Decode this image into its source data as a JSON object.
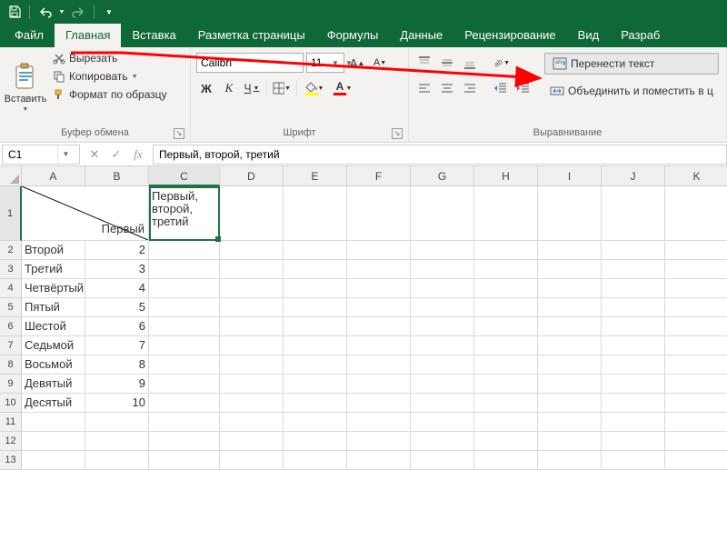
{
  "qat": {
    "save": "save",
    "undo": "undo",
    "redo": "redo",
    "customize": "customize"
  },
  "tabs": [
    "Файл",
    "Главная",
    "Вставка",
    "Разметка страницы",
    "Формулы",
    "Данные",
    "Рецензирование",
    "Вид",
    "Разраб"
  ],
  "active_tab": 1,
  "clipboard": {
    "paste": "Вставить",
    "cut": "Вырезать",
    "copy": "Копировать",
    "format_painter": "Формат по образцу",
    "group": "Буфер обмена"
  },
  "font": {
    "name": "Calibri",
    "size": "11",
    "bold": "Ж",
    "italic": "К",
    "underline": "Ч",
    "group": "Шрифт"
  },
  "alignment": {
    "wrap": "Перенести текст",
    "merge": "Объединить и поместить в ц",
    "group": "Выравнивание"
  },
  "namebox": "C1",
  "formula": "Первый, второй, третий",
  "columns": [
    "A",
    "B",
    "C",
    "D",
    "E",
    "F",
    "G",
    "H",
    "I",
    "J",
    "K"
  ],
  "rows": [
    1,
    2,
    3,
    4,
    5,
    6,
    7,
    8,
    9,
    10,
    11,
    12,
    13
  ],
  "selected_cell": "C1",
  "cell_data": {
    "A1_corner": "Первый",
    "C1": "Первый, второй, третий",
    "rows": [
      {
        "a": "Второй",
        "b": "2"
      },
      {
        "a": "Третий",
        "b": "3"
      },
      {
        "a": "Четвёртый",
        "b": "4"
      },
      {
        "a": "Пятый",
        "b": "5"
      },
      {
        "a": "Шестой",
        "b": "6"
      },
      {
        "a": "Седьмой",
        "b": "7"
      },
      {
        "a": "Восьмой",
        "b": "8"
      },
      {
        "a": "Девятый",
        "b": "9"
      },
      {
        "a": "Десятый",
        "b": "10"
      }
    ]
  },
  "colors": {
    "excel_green": "#0e6837",
    "arrow_red": "#ff0000"
  }
}
